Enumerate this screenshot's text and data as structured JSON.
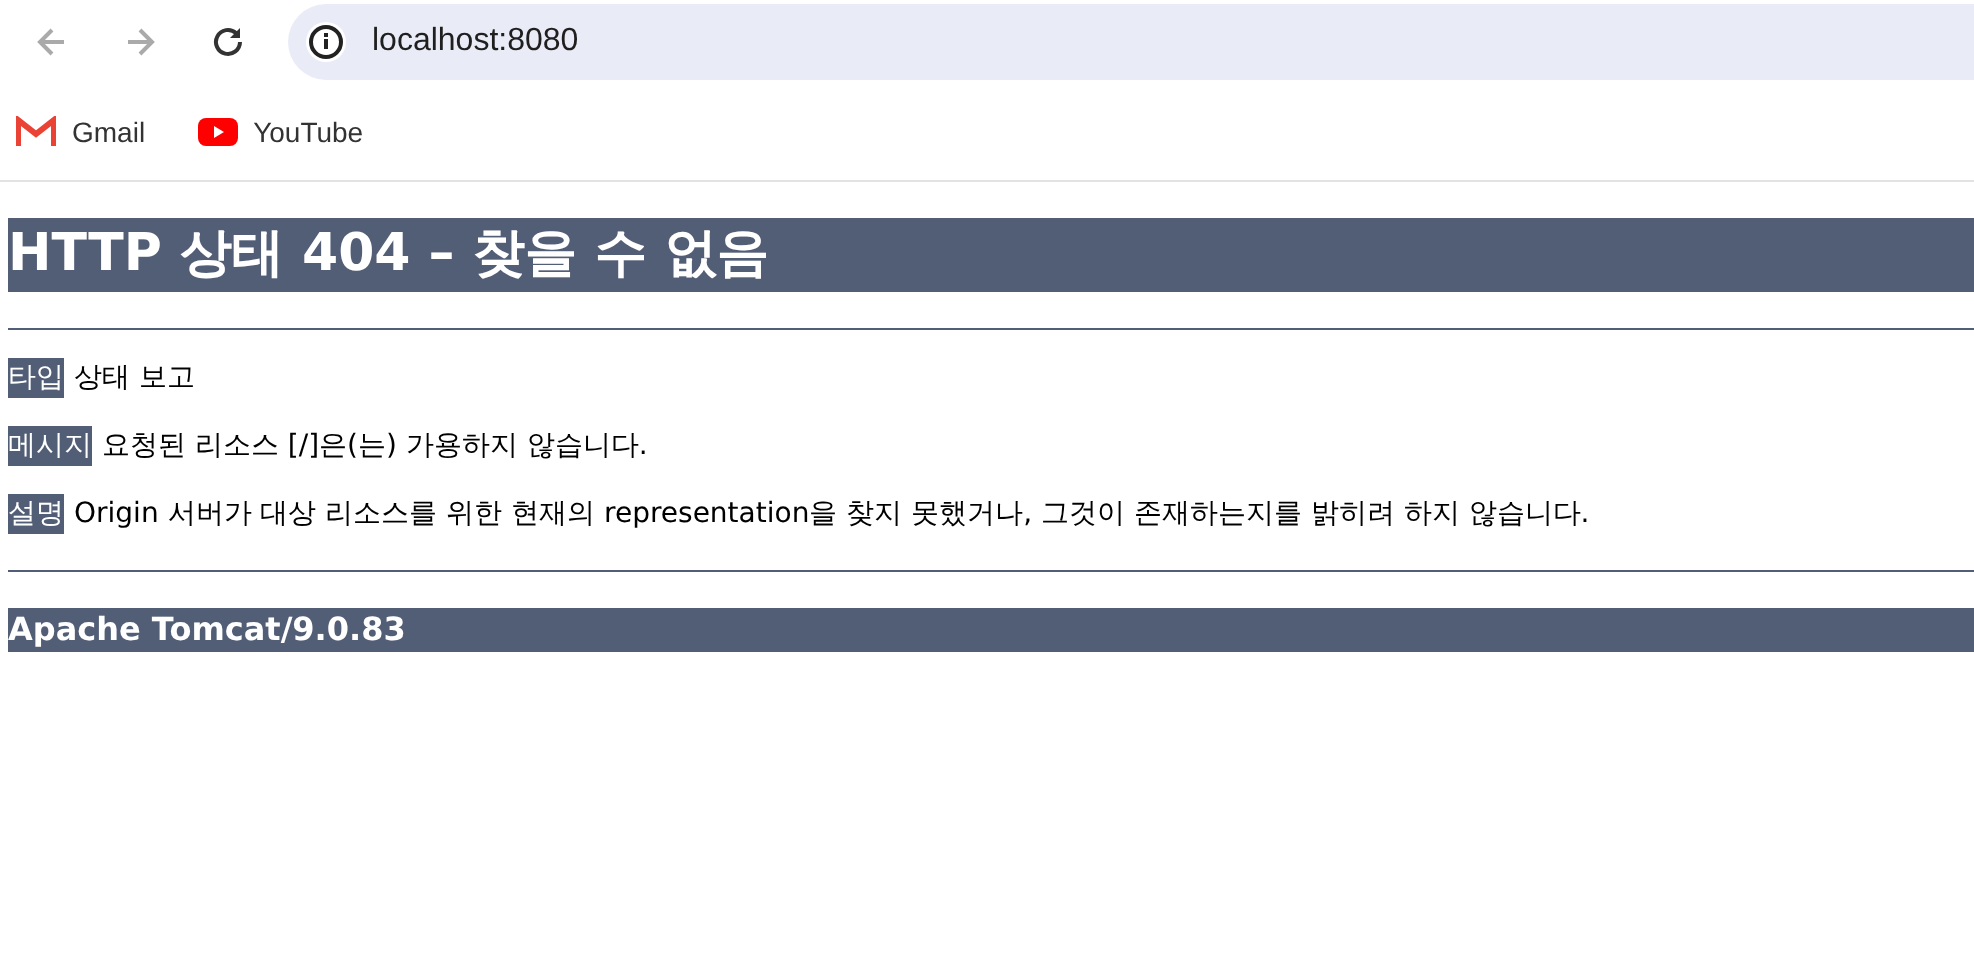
{
  "browser": {
    "url": "localhost:8080",
    "bookmarks": [
      {
        "label": "Gmail",
        "kind": "mail"
      },
      {
        "label": "YouTube",
        "kind": "video"
      }
    ]
  },
  "page": {
    "title": "HTTP 상태 404 – 찾을 수 없음",
    "fields": [
      {
        "label": "타입",
        "value": "상태 보고"
      },
      {
        "label": "메시지",
        "value": "요청된 리소스 [/]은(는) 가용하지 않습니다."
      },
      {
        "label": "설명",
        "value": "Origin 서버가 대상 리소스를 위한 현재의 representation을 찾지 못했거나, 그것이 존재하는지를 밝히려 하지 않습니다."
      }
    ],
    "footer": "Apache Tomcat/9.0.83"
  }
}
